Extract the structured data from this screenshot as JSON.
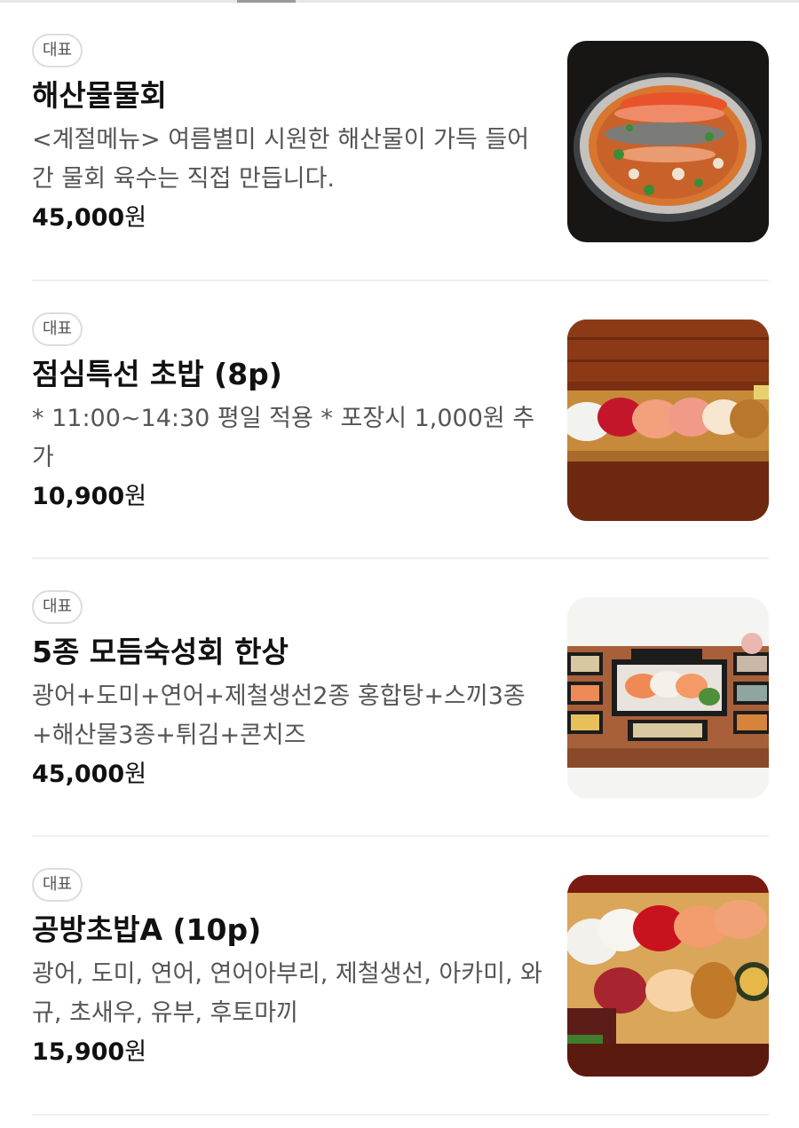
{
  "menu": [
    {
      "badge": "대표",
      "name": "해산물물회",
      "description": "<계절메뉴> 여름별미 시원한 해산물이 가득 들어간 물회 육수는 직접 만듭니다.",
      "price": "45,000",
      "currency": "원"
    },
    {
      "badge": "대표",
      "name": "점심특선 초밥 (8p)",
      "description": "* 11:00~14:30 평일 적용 * 포장시 1,000원 추가",
      "price": "10,900",
      "currency": "원"
    },
    {
      "badge": "대표",
      "name": "5종 모듬숙성회 한상",
      "description": "광어+도미+연어+제철생선2종 홍합탕+스끼3종+해산물3종+튀김+콘치즈",
      "price": "45,000",
      "currency": "원"
    },
    {
      "badge": "대표",
      "name": "공방초밥A (10p)",
      "description": "광어, 도미, 연어, 연어아부리, 제철생선, 아카미, 와규, 초새우, 유부, 후토마끼",
      "price": "15,900",
      "currency": "원"
    }
  ]
}
